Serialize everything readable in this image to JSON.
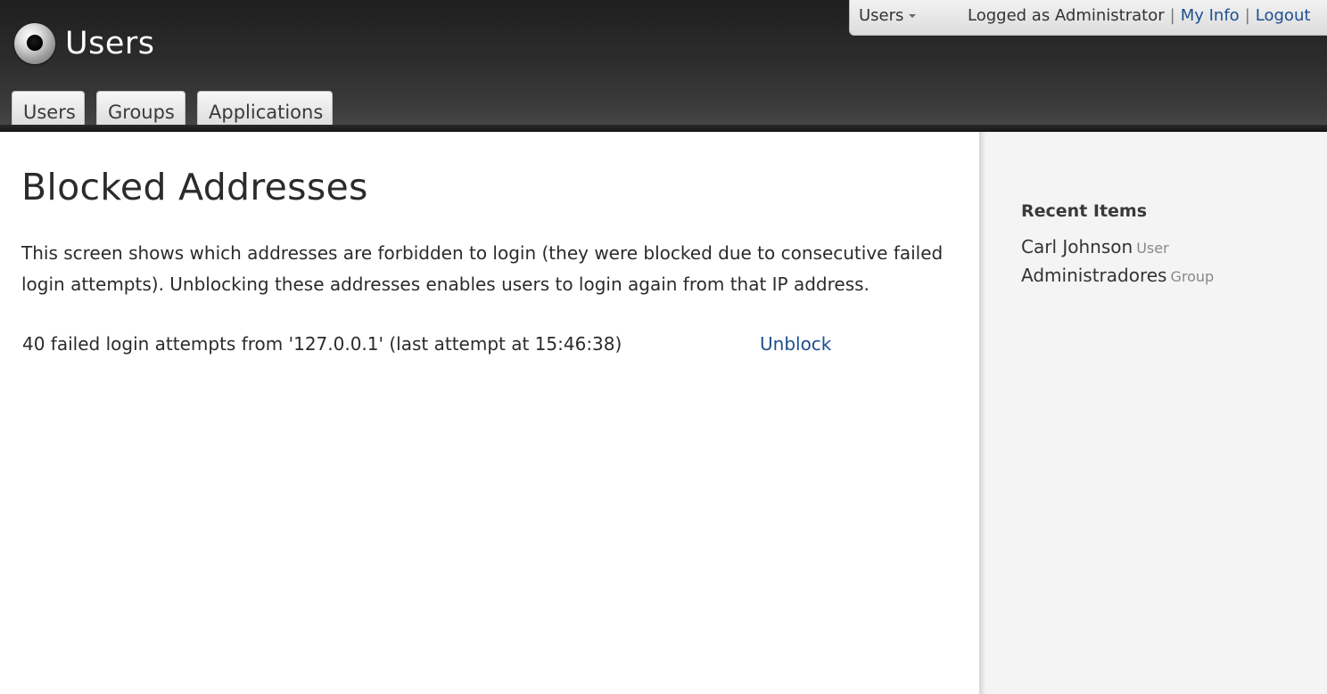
{
  "header": {
    "app_title": "Users",
    "logo_icon": "app-logo-icon",
    "module_selector": "Users",
    "logged_as": "Logged as Administrator",
    "separator": "|",
    "my_info_label": "My Info",
    "logout_label": "Logout",
    "link_color": "#1d4f91"
  },
  "tabs": [
    {
      "label": "Users"
    },
    {
      "label": "Groups"
    },
    {
      "label": "Applications"
    }
  ],
  "main": {
    "title": "Blocked Addresses",
    "description": "This screen shows which addresses are forbidden to login (they were blocked due to consecutive failed login attempts). Unblocking these addresses enables users to login again from that IP address.",
    "blocked": [
      {
        "text": "40 failed login attempts from '127.0.0.1' (last attempt at 15:46:38)",
        "action_label": "Unblock"
      }
    ]
  },
  "sidebar": {
    "title": "Recent Items",
    "items": [
      {
        "name": "Carl Johnson",
        "type": "User"
      },
      {
        "name": "Administradores",
        "type": "Group"
      }
    ]
  }
}
